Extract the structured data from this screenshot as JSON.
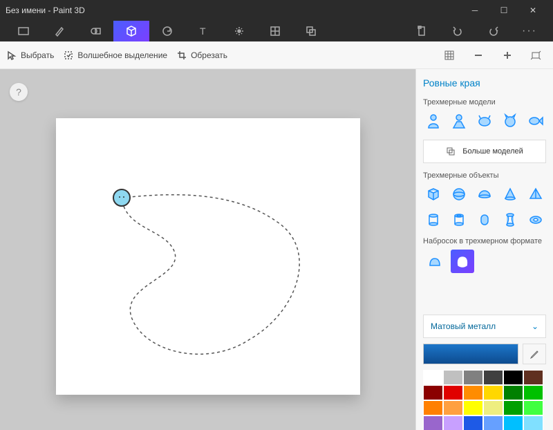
{
  "title": "Без имени - Paint 3D",
  "window_controls": {
    "minimize": "─",
    "maximize": "☐",
    "close": "✕"
  },
  "secondary": {
    "select": "Выбрать",
    "magic": "Волшебное выделение",
    "crop": "Обрезать"
  },
  "help": "?",
  "panel": {
    "title": "Ровные края",
    "models_label": "Трехмерные модели",
    "more_models": "Больше моделей",
    "objects_label": "Трехмерные объекты",
    "doodle_label": "Набросок в трехмерном формате",
    "material": "Матовый металл",
    "chevron": "⌄"
  },
  "palette": [
    "#ffffff",
    "#c0c0c0",
    "#808080",
    "#404040",
    "#000000",
    "#603020",
    "#8b0000",
    "#e00000",
    "#ff8c00",
    "#ffd700",
    "#008000",
    "#00c000",
    "#ff8000",
    "#ffa040",
    "#ffff00",
    "#eeee80",
    "#00a000",
    "#40ff40",
    "#9966cc",
    "#c8a0ff",
    "#1e5ae6",
    "#66a0ff",
    "#00bfff",
    "#80e0ff"
  ]
}
